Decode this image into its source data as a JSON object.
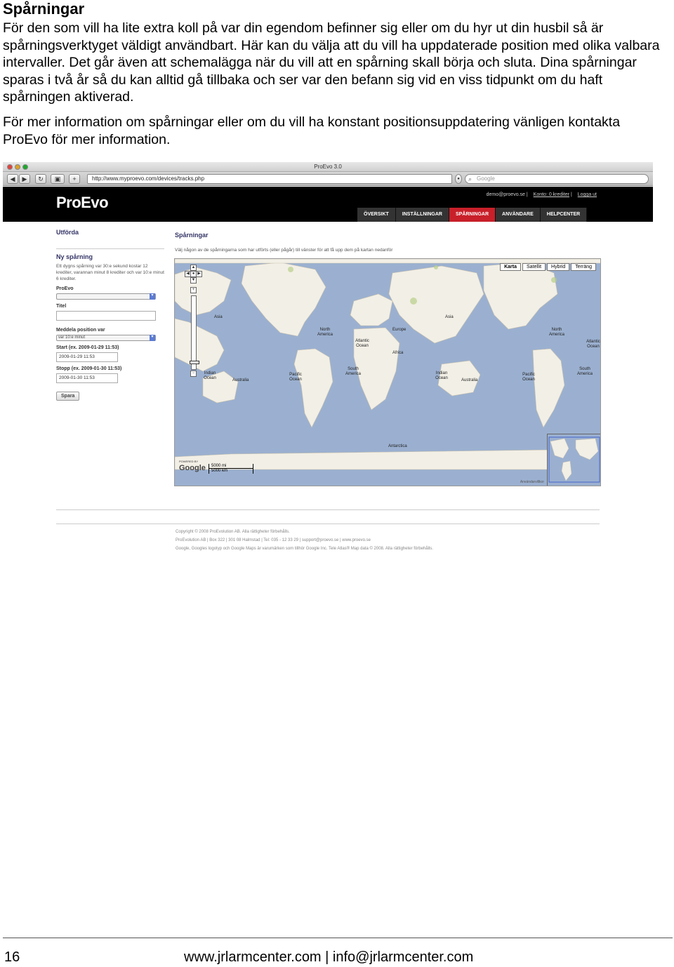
{
  "heading": "Spårningar",
  "paragraph1": "För den som vill ha lite extra koll på var din egendom befinner sig eller om du hyr ut din husbil så är spårningsverktyget väldigt användbart. Här kan du välja att du vill ha uppdaterade position med olika valbara intervaller. Det går även att schemalägga när du vill att en spårning skall börja och sluta. Dina spårningar sparas i två år så du kan alltid gå tillbaka och ser var den befann sig vid en viss tidpunkt om du haft spårningen aktiverad.",
  "paragraph2": "För mer information om spårningar eller om du vill ha konstant positionsuppdatering vänligen kontakta ProEvo för mer information.",
  "screenshot": {
    "window_title": "ProEvo 3.0",
    "url": "http://www.myproevo.com/devices/tracks.php",
    "search_placeholder": "Google",
    "logo": "ProEvo",
    "user_links": [
      "demo@proevo.se",
      "Konto: 0 krediter",
      "Logga ut"
    ],
    "nav": [
      "ÖVERSIKT",
      "INSTÄLLNINGAR",
      "SPÅRNINGAR",
      "ANVÄNDARE",
      "HELPCENTER"
    ],
    "nav_active": "SPÅRNINGAR",
    "sidebar": {
      "section_title": "Utförda",
      "new_title": "Ny spårning",
      "new_desc": "Ett dygns spårning var 30:e sekund kostar 12 krediter, varannan minut 8 krediter och var 10:e minut 6 krediter.",
      "device_label": "ProEvo",
      "title_label": "Titel",
      "interval_label": "Meddela position var",
      "interval_value": "var 10:e minut",
      "start_label": "Start (ex. 2009-01-29 11:53)",
      "start_value": "2009-01-29 11:53",
      "stop_label": "Stopp (ex. 2009-01-30 11:53)",
      "stop_value": "2009-01-30 11:53",
      "save_button": "Spara"
    },
    "main": {
      "title": "Spårningar",
      "description": "Välj någon av de spårningarna som har utförts (eller pågår) till vänster för att få upp dem på kartan nedanför"
    },
    "map": {
      "types": [
        "Karta",
        "Satellit",
        "Hybrid",
        "Terräng"
      ],
      "active_type": "Karta",
      "labels": [
        "Asia",
        "North America",
        "Atlantic Ocean",
        "Europe",
        "Africa",
        "Asia",
        "North America",
        "Atlantic Ocean",
        "Indian Ocean",
        "Australia",
        "South America",
        "Pacific Ocean",
        "Indian Ocean",
        "Australia",
        "Pacific Ocean",
        "South America",
        "Antarctica"
      ],
      "scale_mi": "5000 mi",
      "scale_km": "5000 km",
      "powered_by": "POWERED BY",
      "google": "Google",
      "map_data": "Användarvillkor"
    },
    "footer": [
      "Copyright © 2008 ProEvolution AB. Alla rättigheter förbehålls.",
      "ProEvolution AB | Box 322 | 301 08 Halmstad | Tel: 035 - 12 33 29 | support@proevo.se | www.proevo.se",
      "Google, Googles logotyp och Google Maps är varumärken som tillhör Google Inc. Tele Atlas® Map data © 2008. Alla rättigheter förbehålls."
    ]
  },
  "page_number": "16",
  "contact": "www.jrlarmcenter.com | info@jrlarmcenter.com"
}
